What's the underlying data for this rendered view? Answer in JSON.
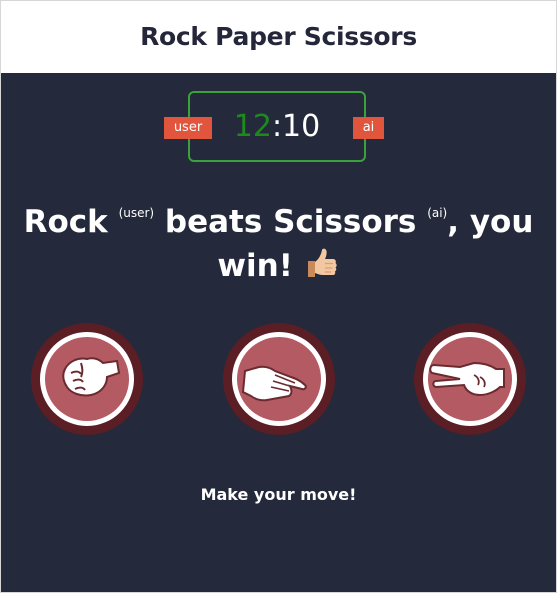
{
  "header": {
    "title": "Rock Paper Scissors"
  },
  "scoreboard": {
    "user_score": "12",
    "separator": ":",
    "ai_score": "10",
    "user_label": "user",
    "ai_label": "ai"
  },
  "result": {
    "user_move": "Rock",
    "user_tag": "(user)",
    "verb": "beats",
    "ai_move": "Scissors",
    "ai_tag": "(ai)",
    "outcome": ", you win!",
    "emoji_icon": "thumbs-up-icon"
  },
  "choices": [
    {
      "name": "rock",
      "icon": "rock-fist-icon"
    },
    {
      "name": "paper",
      "icon": "paper-hand-icon"
    },
    {
      "name": "scissors",
      "icon": "scissors-hand-icon"
    }
  ],
  "prompt": "Make your move!",
  "colors": {
    "board_bg": "#24293b",
    "accent_green": "#3aa23a",
    "user_score_green": "#1e8a1e",
    "badge_red": "#e2553d",
    "choice_fill": "#b45a62",
    "choice_ring": "#5a1e24"
  }
}
